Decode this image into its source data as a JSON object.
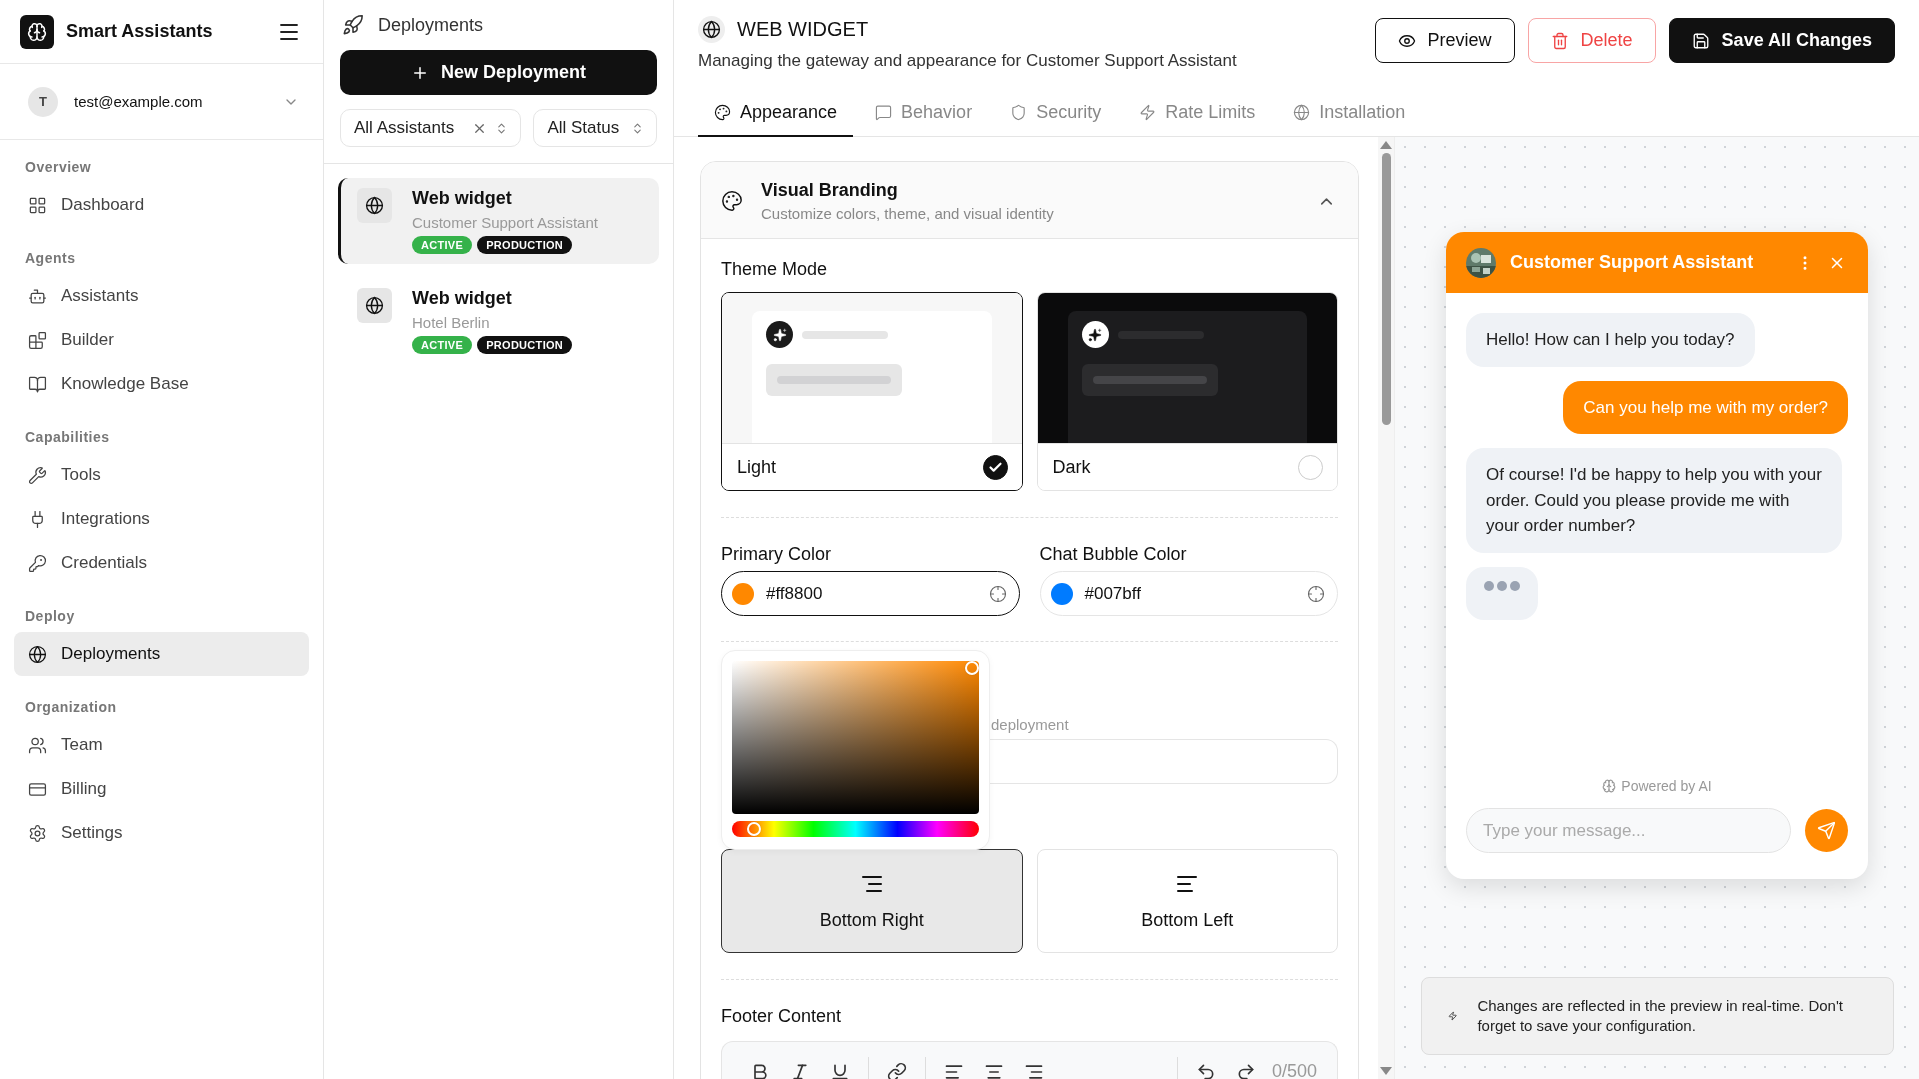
{
  "sidebar": {
    "brand": "Smart Assistants",
    "user": {
      "initial": "T",
      "email": "test@example.com"
    },
    "sections": [
      {
        "title": "Overview",
        "items": [
          {
            "label": "Dashboard",
            "selected": false
          }
        ]
      },
      {
        "title": "Agents",
        "items": [
          {
            "label": "Assistants",
            "selected": false
          },
          {
            "label": "Builder",
            "selected": false
          },
          {
            "label": "Knowledge Base",
            "selected": false
          }
        ]
      },
      {
        "title": "Capabilities",
        "items": [
          {
            "label": "Tools",
            "selected": false
          },
          {
            "label": "Integrations",
            "selected": false
          },
          {
            "label": "Credentials",
            "selected": false
          }
        ]
      },
      {
        "title": "Deploy",
        "items": [
          {
            "label": "Deployments",
            "selected": true
          }
        ]
      },
      {
        "title": "Organization",
        "items": [
          {
            "label": "Team",
            "selected": false
          },
          {
            "label": "Billing",
            "selected": false
          },
          {
            "label": "Settings",
            "selected": false
          }
        ]
      }
    ]
  },
  "deployments_panel": {
    "title": "Deployments",
    "new_button": "New Deployment",
    "filters": [
      {
        "value": "All Assistants",
        "clearable": true
      },
      {
        "value": "All Status",
        "clearable": false
      }
    ],
    "items": [
      {
        "name": "Web widget",
        "assistant": "Customer Support Assistant",
        "selected": true,
        "badges": [
          {
            "label": "ACTIVE",
            "kind": "status"
          },
          {
            "label": "PRODUCTION",
            "kind": "env"
          }
        ]
      },
      {
        "name": "Web widget",
        "assistant": "Hotel Berlin",
        "selected": false,
        "badges": [
          {
            "label": "ACTIVE",
            "kind": "status"
          },
          {
            "label": "PRODUCTION",
            "kind": "env"
          }
        ]
      }
    ]
  },
  "header": {
    "title": "WEB WIDGET",
    "subtitle": "Managing the gateway and appearance for Customer Support Assistant",
    "buttons": [
      {
        "label": "Preview",
        "kind": "outline"
      },
      {
        "label": "Delete",
        "kind": "danger"
      },
      {
        "label": "Save All Changes",
        "kind": "primary"
      }
    ]
  },
  "tabs": [
    {
      "label": "Appearance",
      "selected": true
    },
    {
      "label": "Behavior",
      "selected": false
    },
    {
      "label": "Security",
      "selected": false
    },
    {
      "label": "Rate Limits",
      "selected": false
    },
    {
      "label": "Installation",
      "selected": false
    }
  ],
  "visual_branding": {
    "title": "Visual Branding",
    "subtitle": "Customize colors, theme, and visual identity",
    "expanded": true,
    "theme_mode": {
      "label": "Theme Mode",
      "options": [
        {
          "label": "Light",
          "kind": "light",
          "selected": true
        },
        {
          "label": "Dark",
          "kind": "dark",
          "selected": false
        }
      ]
    },
    "colors": [
      {
        "label": "Primary Color",
        "value": "#ff8800",
        "color": "#ff8800",
        "focused": true
      },
      {
        "label": "Chat Bubble Color",
        "value": "#007bff",
        "color": "#007bff",
        "focused": false
      }
    ],
    "color_picker": {
      "open": true,
      "hue": {
        "level": 0.09
      }
    },
    "covered_field": {
      "label": "deployment"
    },
    "positions": [
      {
        "label": "Bottom Right",
        "selected": true
      },
      {
        "label": "Bottom Left",
        "selected": false
      }
    ],
    "footer_content": {
      "label": "Footer Content",
      "counter": "0/500"
    }
  },
  "preview": {
    "assistant_name": "Customer Support Assistant",
    "messages": [
      {
        "kind": "bot",
        "text": "Hello! How can I help you today?"
      },
      {
        "kind": "user",
        "text": "Can you help me with my order?"
      },
      {
        "kind": "bot",
        "text": "Of course! I'd be happy to help you with your order. Could you please provide me with your order number?"
      }
    ],
    "typing": true,
    "powered_by": "Powered by AI",
    "input_placeholder": "Type your message...",
    "notice": "Changes are reflected in the preview in real-time. Don't forget to save your configuration."
  }
}
